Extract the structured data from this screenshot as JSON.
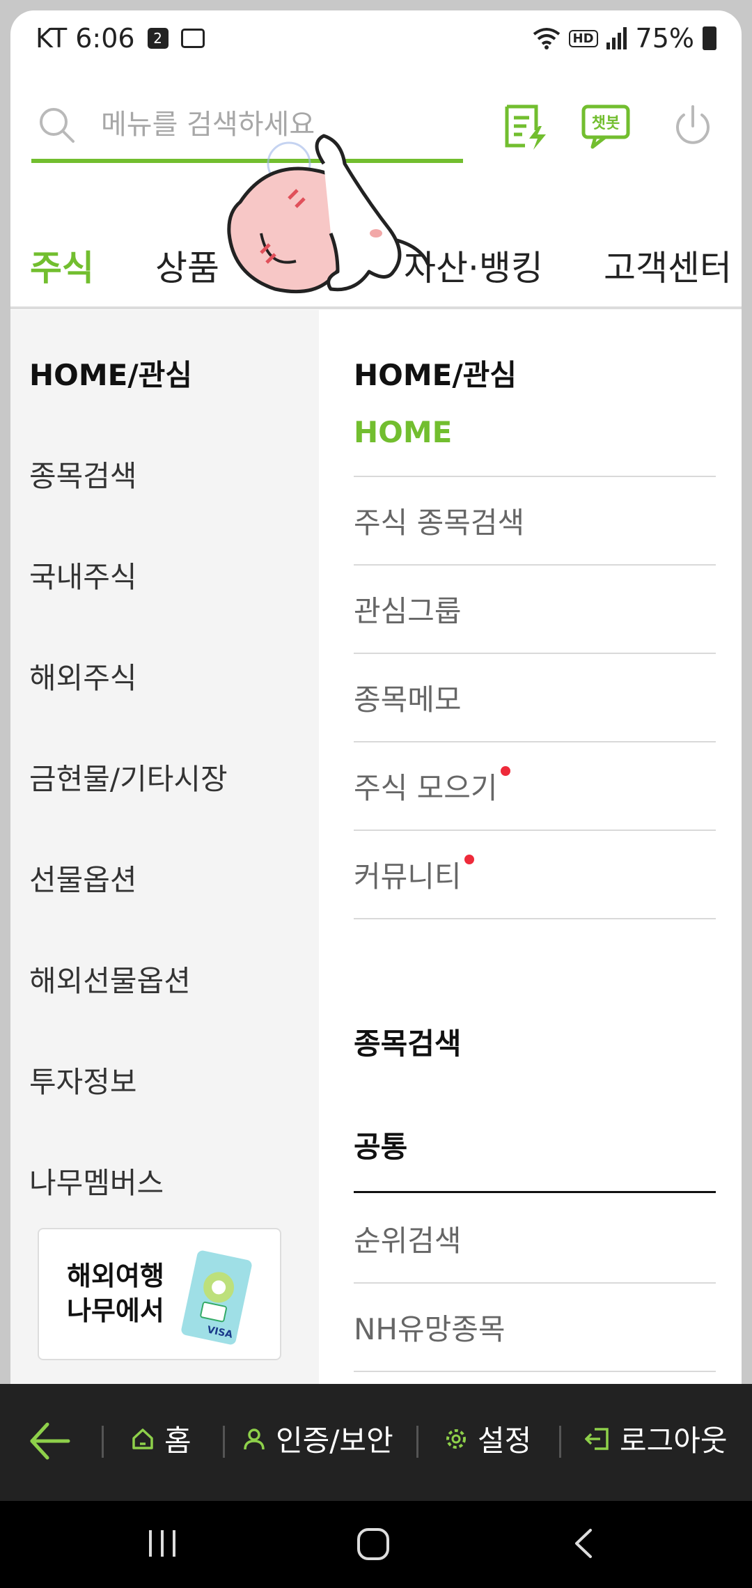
{
  "status_bar": {
    "carrier_time": "KT 6:06",
    "calendar_badge": "2",
    "hd_label": "HD",
    "battery": "75%"
  },
  "search": {
    "placeholder": "메뉴를 검색하세요"
  },
  "chatbot": {
    "label": "챗봇"
  },
  "tabs": [
    {
      "label": "주식",
      "active": true
    },
    {
      "label": "상품",
      "active": false
    },
    {
      "label": "자산·뱅킹",
      "active": false
    },
    {
      "label": "고객센터",
      "active": false
    }
  ],
  "categories": [
    {
      "label": "HOME/관심",
      "active": true
    },
    {
      "label": "종목검색",
      "active": false
    },
    {
      "label": "국내주식",
      "active": false
    },
    {
      "label": "해외주식",
      "active": false
    },
    {
      "label": "금현물/기타시장",
      "active": false
    },
    {
      "label": "선물옵션",
      "active": false
    },
    {
      "label": "해외선물옵션",
      "active": false
    },
    {
      "label": "투자정보",
      "active": false
    },
    {
      "label": "나무멤버스",
      "active": false
    }
  ],
  "promo": {
    "line1": "해외여행",
    "line2": "나무에서",
    "card_brand": "VISA"
  },
  "content": {
    "section1_title": "HOME/관심",
    "section1_items": [
      {
        "label": "HOME",
        "active": true,
        "new": false
      },
      {
        "label": "주식 종목검색",
        "active": false,
        "new": false
      },
      {
        "label": "관심그룹",
        "active": false,
        "new": false
      },
      {
        "label": "종목메모",
        "active": false,
        "new": false
      },
      {
        "label": "주식 모으기",
        "active": false,
        "new": true
      },
      {
        "label": "커뮤니티",
        "active": false,
        "new": true
      }
    ],
    "section2_title": "종목검색",
    "section2_subhead": "공통",
    "section2_items": [
      {
        "label": "순위검색"
      },
      {
        "label": "NH유망종목"
      }
    ]
  },
  "bottom_bar": {
    "home": "홈",
    "auth": "인증/보안",
    "settings": "설정",
    "logout": "로그아웃"
  },
  "colors": {
    "accent": "#72be2f",
    "new_dot": "#ee2a3a",
    "bottom_bar": "#222222"
  }
}
